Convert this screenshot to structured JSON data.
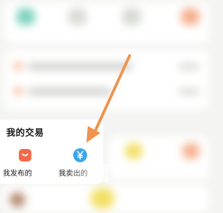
{
  "trade_section": {
    "title": "我的交易",
    "items": [
      {
        "label": "我发布的",
        "icon": "shopping-bag-icon",
        "color": "#f26b4a"
      },
      {
        "label": "我卖出的",
        "icon": "yen-icon",
        "color": "#3aa6e8"
      }
    ]
  },
  "annotation": {
    "arrow_color": "#f0934a"
  },
  "colors": {
    "teal": "#7fd3c1",
    "orange": "#f5b08e",
    "yellow": "#f3e066",
    "brown": "#b48a6d"
  }
}
